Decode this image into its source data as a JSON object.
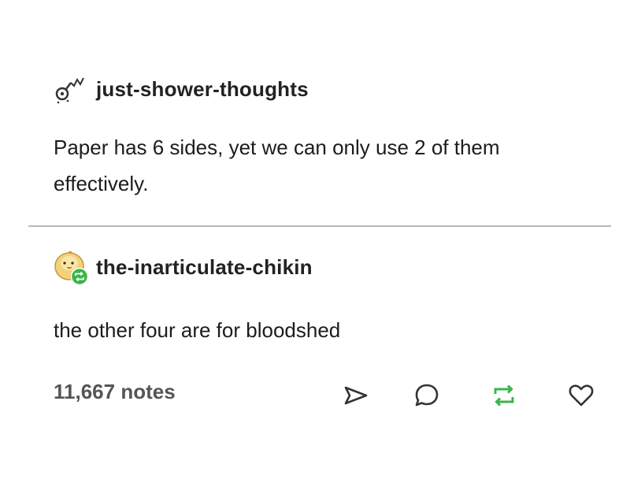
{
  "post": {
    "original": {
      "username": "just-shower-thoughts",
      "avatar_icon": "shower-head-icon",
      "text": "Paper has 6 sides, yet we can only use 2 of them effectively."
    },
    "reply": {
      "username": "the-inarticulate-chikin",
      "avatar_icon": "chick-avatar-icon",
      "badge_icon": "reblog-badge-icon",
      "text": "the other four are for bloodshed"
    },
    "notes_label": "11,667 notes",
    "actions": {
      "share_icon": "share-icon",
      "reply_icon": "reply-icon",
      "reblog_icon": "reblog-icon",
      "like_icon": "heart-icon"
    },
    "colors": {
      "reblog_green": "#3bb54a",
      "text_dark": "#1c1c1c",
      "notes_gray": "#555555",
      "divider_gray": "#b9b9b9"
    }
  }
}
